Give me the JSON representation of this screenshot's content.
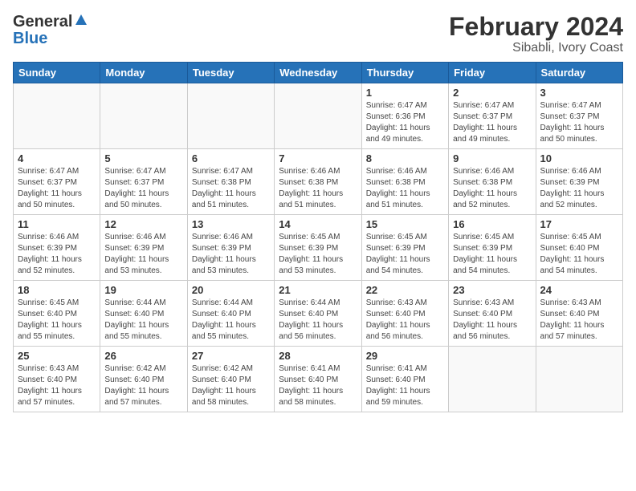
{
  "header": {
    "logo_general": "General",
    "logo_blue": "Blue",
    "month_title": "February 2024",
    "location": "Sibabli, Ivory Coast"
  },
  "days_of_week": [
    "Sunday",
    "Monday",
    "Tuesday",
    "Wednesday",
    "Thursday",
    "Friday",
    "Saturday"
  ],
  "weeks": [
    [
      {
        "day": "",
        "info": ""
      },
      {
        "day": "",
        "info": ""
      },
      {
        "day": "",
        "info": ""
      },
      {
        "day": "",
        "info": ""
      },
      {
        "day": "1",
        "info": "Sunrise: 6:47 AM\nSunset: 6:36 PM\nDaylight: 11 hours and 49 minutes."
      },
      {
        "day": "2",
        "info": "Sunrise: 6:47 AM\nSunset: 6:37 PM\nDaylight: 11 hours and 49 minutes."
      },
      {
        "day": "3",
        "info": "Sunrise: 6:47 AM\nSunset: 6:37 PM\nDaylight: 11 hours and 50 minutes."
      }
    ],
    [
      {
        "day": "4",
        "info": "Sunrise: 6:47 AM\nSunset: 6:37 PM\nDaylight: 11 hours and 50 minutes."
      },
      {
        "day": "5",
        "info": "Sunrise: 6:47 AM\nSunset: 6:37 PM\nDaylight: 11 hours and 50 minutes."
      },
      {
        "day": "6",
        "info": "Sunrise: 6:47 AM\nSunset: 6:38 PM\nDaylight: 11 hours and 51 minutes."
      },
      {
        "day": "7",
        "info": "Sunrise: 6:46 AM\nSunset: 6:38 PM\nDaylight: 11 hours and 51 minutes."
      },
      {
        "day": "8",
        "info": "Sunrise: 6:46 AM\nSunset: 6:38 PM\nDaylight: 11 hours and 51 minutes."
      },
      {
        "day": "9",
        "info": "Sunrise: 6:46 AM\nSunset: 6:38 PM\nDaylight: 11 hours and 52 minutes."
      },
      {
        "day": "10",
        "info": "Sunrise: 6:46 AM\nSunset: 6:39 PM\nDaylight: 11 hours and 52 minutes."
      }
    ],
    [
      {
        "day": "11",
        "info": "Sunrise: 6:46 AM\nSunset: 6:39 PM\nDaylight: 11 hours and 52 minutes."
      },
      {
        "day": "12",
        "info": "Sunrise: 6:46 AM\nSunset: 6:39 PM\nDaylight: 11 hours and 53 minutes."
      },
      {
        "day": "13",
        "info": "Sunrise: 6:46 AM\nSunset: 6:39 PM\nDaylight: 11 hours and 53 minutes."
      },
      {
        "day": "14",
        "info": "Sunrise: 6:45 AM\nSunset: 6:39 PM\nDaylight: 11 hours and 53 minutes."
      },
      {
        "day": "15",
        "info": "Sunrise: 6:45 AM\nSunset: 6:39 PM\nDaylight: 11 hours and 54 minutes."
      },
      {
        "day": "16",
        "info": "Sunrise: 6:45 AM\nSunset: 6:39 PM\nDaylight: 11 hours and 54 minutes."
      },
      {
        "day": "17",
        "info": "Sunrise: 6:45 AM\nSunset: 6:40 PM\nDaylight: 11 hours and 54 minutes."
      }
    ],
    [
      {
        "day": "18",
        "info": "Sunrise: 6:45 AM\nSunset: 6:40 PM\nDaylight: 11 hours and 55 minutes."
      },
      {
        "day": "19",
        "info": "Sunrise: 6:44 AM\nSunset: 6:40 PM\nDaylight: 11 hours and 55 minutes."
      },
      {
        "day": "20",
        "info": "Sunrise: 6:44 AM\nSunset: 6:40 PM\nDaylight: 11 hours and 55 minutes."
      },
      {
        "day": "21",
        "info": "Sunrise: 6:44 AM\nSunset: 6:40 PM\nDaylight: 11 hours and 56 minutes."
      },
      {
        "day": "22",
        "info": "Sunrise: 6:43 AM\nSunset: 6:40 PM\nDaylight: 11 hours and 56 minutes."
      },
      {
        "day": "23",
        "info": "Sunrise: 6:43 AM\nSunset: 6:40 PM\nDaylight: 11 hours and 56 minutes."
      },
      {
        "day": "24",
        "info": "Sunrise: 6:43 AM\nSunset: 6:40 PM\nDaylight: 11 hours and 57 minutes."
      }
    ],
    [
      {
        "day": "25",
        "info": "Sunrise: 6:43 AM\nSunset: 6:40 PM\nDaylight: 11 hours and 57 minutes."
      },
      {
        "day": "26",
        "info": "Sunrise: 6:42 AM\nSunset: 6:40 PM\nDaylight: 11 hours and 57 minutes."
      },
      {
        "day": "27",
        "info": "Sunrise: 6:42 AM\nSunset: 6:40 PM\nDaylight: 11 hours and 58 minutes."
      },
      {
        "day": "28",
        "info": "Sunrise: 6:41 AM\nSunset: 6:40 PM\nDaylight: 11 hours and 58 minutes."
      },
      {
        "day": "29",
        "info": "Sunrise: 6:41 AM\nSunset: 6:40 PM\nDaylight: 11 hours and 59 minutes."
      },
      {
        "day": "",
        "info": ""
      },
      {
        "day": "",
        "info": ""
      }
    ]
  ]
}
